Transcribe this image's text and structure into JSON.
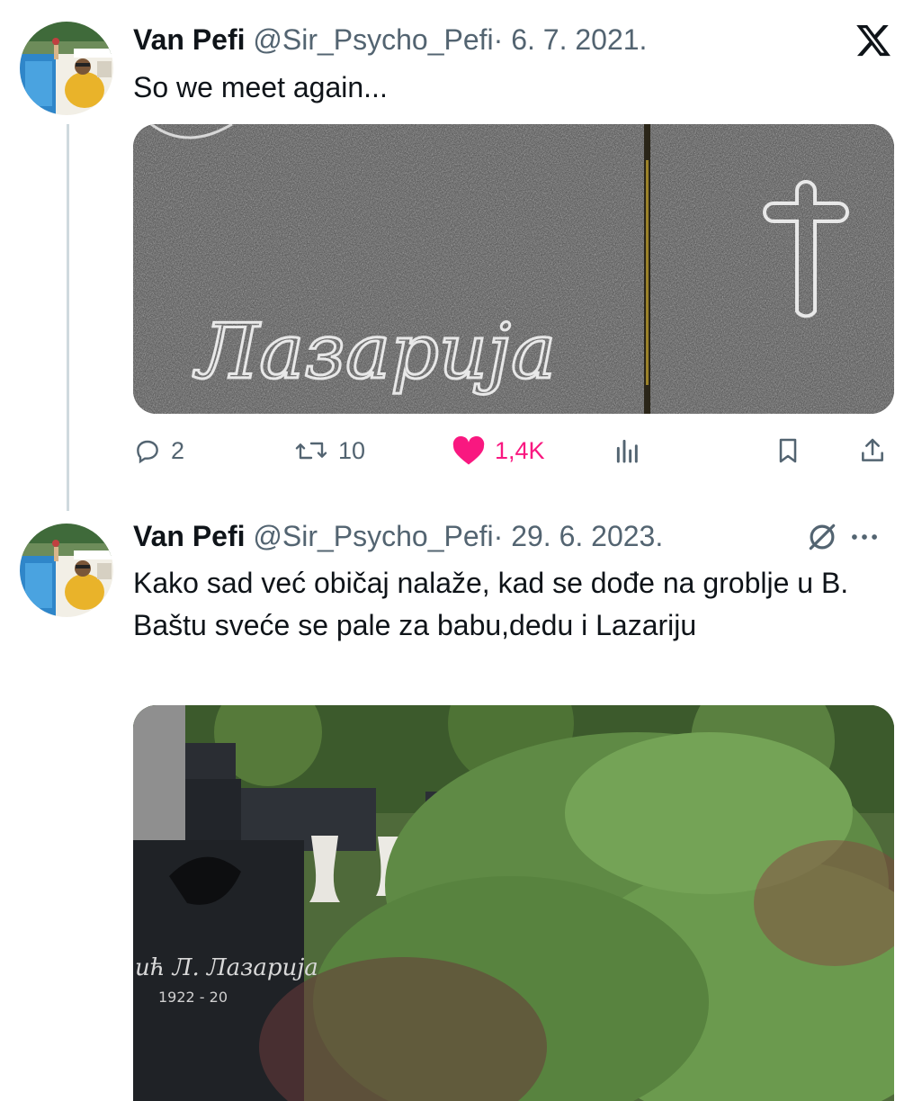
{
  "tweet1": {
    "author_name": "Van Pefi",
    "handle": "@Sir_Psycho_Pefi",
    "separator": "·",
    "date": "6. 7. 2021.",
    "text": "So we meet again...",
    "media_text": "Лазарија",
    "stats": {
      "replies": "2",
      "reposts": "10",
      "likes": "1,4K"
    }
  },
  "tweet2": {
    "author_name": "Van Pefi",
    "handle": "@Sir_Psycho_Pefi",
    "separator": "·",
    "date": "29. 6. 2023.",
    "text": "Kako sad već običaj nalaže, kad se dođe na groblje u B. Baštu sveće se pale za babu,dedu i Lazariju",
    "media_text": "ић Л. Лазарија",
    "media_years": "1922 - 20"
  },
  "colors": {
    "like": "#f91880",
    "secondary_text": "#536471",
    "thread_line": "#cfd9de"
  },
  "icons": {
    "x_logo": "x-logo-icon",
    "reply": "reply-icon",
    "repost": "repost-icon",
    "like": "heart-filled-icon",
    "views": "views-chart-icon",
    "bookmark": "bookmark-icon",
    "share": "share-icon",
    "grok": "grok-icon",
    "more": "more-dots-icon"
  }
}
